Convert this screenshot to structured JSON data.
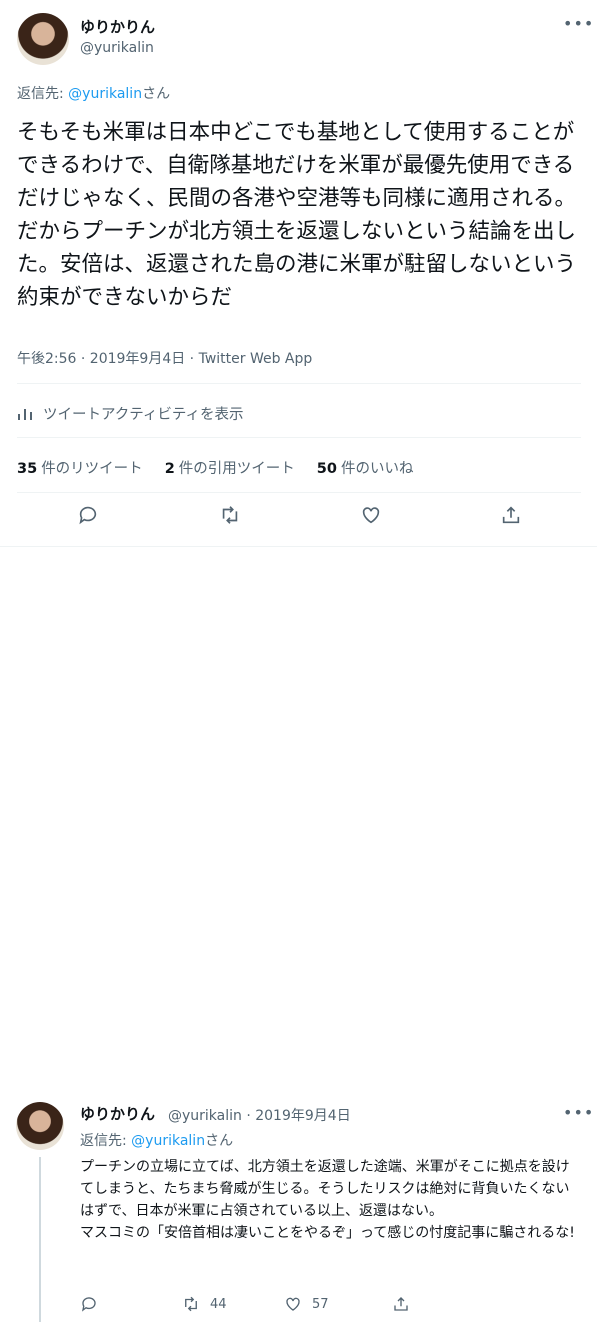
{
  "tweet": {
    "display_name": "ゆりかりん",
    "handle": "@yurikalin",
    "reply_to_label": "返信先: ",
    "reply_to_handle": "@yurikalin",
    "reply_to_suffix": "さん",
    "text": "そもそも米軍は日本中どこでも基地として使用することができるわけで、自衛隊基地だけを米軍が最優先使用できるだけじゃなく、民間の各港や空港等も同様に適用される。だからプーチンが北方領土を返還しないという結論を出した。安倍は、返還された島の港に米軍が駐留しないという約束ができないからだ",
    "meta": "午後2:56 · 2019年9月4日 · Twitter Web App",
    "activity_label": "ツイートアクティビティを表示",
    "stats": [
      {
        "count": "35",
        "label": "件のリツイート"
      },
      {
        "count": "2",
        "label": "件の引用ツイート"
      },
      {
        "count": "50",
        "label": "件のいいね"
      }
    ]
  },
  "reply": {
    "display_name": "ゆりかりん",
    "meta": "@yurikalin · 2019年9月4日",
    "reply_to_label": "返信先: ",
    "reply_to_handle": "@yurikalin",
    "reply_to_suffix": "さん",
    "text": "プーチンの立場に立てば、北方領土を返還した途端、米軍がそこに拠点を設けてしまうと、たちまち脅威が生じる。そうしたリスクは絶対に背負いたくないはずで、日本が米軍に占領されている以上、返還はない。\nマスコミの「安倍首相は凄いことをやるぞ」って感じの忖度記事に騙されるな!",
    "retweet_count": "44",
    "like_count": "57"
  },
  "icons": [
    "reply-icon",
    "retweet-icon",
    "like-icon",
    "share-icon",
    "more-icon",
    "chart-icon"
  ]
}
